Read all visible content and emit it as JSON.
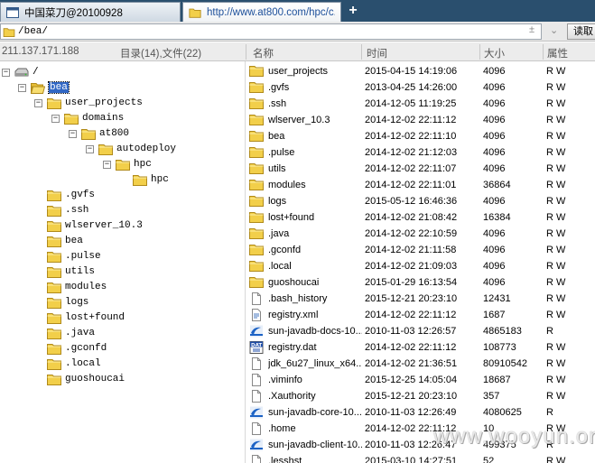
{
  "tabs": [
    {
      "label": "中国菜刀@20100928"
    },
    {
      "label": "http://www.at800.com/hpc/c..."
    }
  ],
  "new_tab_label": "+",
  "address": {
    "value": "/bea/",
    "read_button": "读取",
    "controls": [
      "±",
      "⌄"
    ]
  },
  "header": {
    "host": "211.137.171.188",
    "summary": "目录(14),文件(22)",
    "col_name": "名称",
    "col_time": "时间",
    "col_size": "大小",
    "col_attr": "属性"
  },
  "tree": [
    {
      "label": "/",
      "level": 0,
      "icon": "drive-icon",
      "expander": "−"
    },
    {
      "label": "bea",
      "level": 1,
      "icon": "folder-open-icon",
      "expander": "−",
      "selected": true
    },
    {
      "label": "user_projects",
      "level": 2,
      "icon": "folder-icon",
      "expander": "−"
    },
    {
      "label": "domains",
      "level": 3,
      "icon": "folder-icon",
      "expander": "−"
    },
    {
      "label": "at800",
      "level": 4,
      "icon": "folder-icon",
      "expander": "−"
    },
    {
      "label": "autodeploy",
      "level": 5,
      "icon": "folder-icon",
      "expander": "−"
    },
    {
      "label": "hpc",
      "level": 6,
      "icon": "folder-icon",
      "expander": "−"
    },
    {
      "label": "hpc",
      "level": 7,
      "icon": "folder-icon",
      "expander": ""
    },
    {
      "label": ".gvfs",
      "level": 2,
      "icon": "folder-icon",
      "expander": ""
    },
    {
      "label": ".ssh",
      "level": 2,
      "icon": "folder-icon",
      "expander": ""
    },
    {
      "label": "wlserver_10.3",
      "level": 2,
      "icon": "folder-icon",
      "expander": ""
    },
    {
      "label": "bea",
      "level": 2,
      "icon": "folder-icon",
      "expander": ""
    },
    {
      "label": ".pulse",
      "level": 2,
      "icon": "folder-icon",
      "expander": ""
    },
    {
      "label": "utils",
      "level": 2,
      "icon": "folder-icon",
      "expander": ""
    },
    {
      "label": "modules",
      "level": 2,
      "icon": "folder-icon",
      "expander": ""
    },
    {
      "label": "logs",
      "level": 2,
      "icon": "folder-icon",
      "expander": ""
    },
    {
      "label": "lost+found",
      "level": 2,
      "icon": "folder-icon",
      "expander": ""
    },
    {
      "label": ".java",
      "level": 2,
      "icon": "folder-icon",
      "expander": ""
    },
    {
      "label": ".gconfd",
      "level": 2,
      "icon": "folder-icon",
      "expander": ""
    },
    {
      "label": ".local",
      "level": 2,
      "icon": "folder-icon",
      "expander": ""
    },
    {
      "label": "guoshoucai",
      "level": 2,
      "icon": "folder-icon",
      "expander": ""
    }
  ],
  "files": [
    {
      "name": "user_projects",
      "time": "2015-04-15 14:19:06",
      "size": "4096",
      "attr": "R W",
      "icon": "folder-icon"
    },
    {
      "name": ".gvfs",
      "time": "2013-04-25 14:26:00",
      "size": "4096",
      "attr": "R W",
      "icon": "folder-icon"
    },
    {
      "name": ".ssh",
      "time": "2014-12-05 11:19:25",
      "size": "4096",
      "attr": "R W",
      "icon": "folder-icon"
    },
    {
      "name": "wlserver_10.3",
      "time": "2014-12-02 22:11:12",
      "size": "4096",
      "attr": "R W",
      "icon": "folder-icon"
    },
    {
      "name": "bea",
      "time": "2014-12-02 22:11:10",
      "size": "4096",
      "attr": "R W",
      "icon": "folder-icon"
    },
    {
      "name": ".pulse",
      "time": "2014-12-02 21:12:03",
      "size": "4096",
      "attr": "R W",
      "icon": "folder-icon"
    },
    {
      "name": "utils",
      "time": "2014-12-02 22:11:07",
      "size": "4096",
      "attr": "R W",
      "icon": "folder-icon"
    },
    {
      "name": "modules",
      "time": "2014-12-02 22:11:01",
      "size": "36864",
      "attr": "R W",
      "icon": "folder-icon"
    },
    {
      "name": "logs",
      "time": "2015-05-12 16:46:36",
      "size": "4096",
      "attr": "R W",
      "icon": "folder-icon"
    },
    {
      "name": "lost+found",
      "time": "2014-12-02 21:08:42",
      "size": "16384",
      "attr": "R W",
      "icon": "folder-icon"
    },
    {
      "name": ".java",
      "time": "2014-12-02 22:10:59",
      "size": "4096",
      "attr": "R W",
      "icon": "folder-icon"
    },
    {
      "name": ".gconfd",
      "time": "2014-12-02 21:11:58",
      "size": "4096",
      "attr": "R W",
      "icon": "folder-icon"
    },
    {
      "name": ".local",
      "time": "2014-12-02 21:09:03",
      "size": "4096",
      "attr": "R W",
      "icon": "folder-icon"
    },
    {
      "name": "guoshoucai",
      "time": "2015-01-29 16:13:54",
      "size": "4096",
      "attr": "R W",
      "icon": "folder-icon"
    },
    {
      "name": ".bash_history",
      "time": "2015-12-21 20:23:10",
      "size": "12431",
      "attr": "R W",
      "icon": "file-icon"
    },
    {
      "name": "registry.xml",
      "time": "2014-12-02 22:11:12",
      "size": "1687",
      "attr": "R W",
      "icon": "xml-file-icon"
    },
    {
      "name": "sun-javadb-docs-10....",
      "time": "2010-11-03 12:26:57",
      "size": "4865183",
      "attr": "R",
      "icon": "package-icon"
    },
    {
      "name": "registry.dat",
      "time": "2014-12-02 22:11:12",
      "size": "108773",
      "attr": "R W",
      "icon": "dat-file-icon"
    },
    {
      "name": "jdk_6u27_linux_x64....",
      "time": "2014-12-02 21:36:51",
      "size": "80910542",
      "attr": "R W",
      "icon": "file-icon"
    },
    {
      "name": ".viminfo",
      "time": "2015-12-25 14:05:04",
      "size": "18687",
      "attr": "R W",
      "icon": "file-icon"
    },
    {
      "name": ".Xauthority",
      "time": "2015-12-21 20:23:10",
      "size": "357",
      "attr": "R W",
      "icon": "file-icon"
    },
    {
      "name": "sun-javadb-core-10....",
      "time": "2010-11-03 12:26:49",
      "size": "4080625",
      "attr": "R",
      "icon": "package-icon"
    },
    {
      "name": ".home",
      "time": "2014-12-02 22:11:12",
      "size": "10",
      "attr": "R W",
      "icon": "file-icon"
    },
    {
      "name": "sun-javadb-client-10...",
      "time": "2010-11-03 12:26:47",
      "size": "499375",
      "attr": "R",
      "icon": "package-icon"
    },
    {
      "name": ".lesshst",
      "time": "2015-03-10 14:27:51",
      "size": "52",
      "attr": "R W",
      "icon": "file-icon"
    }
  ],
  "watermark": "www.wooyun.org",
  "colors": {
    "folder": "#f2cf4a",
    "selection": "#3167c4",
    "tabbar": "#2a4f6e"
  }
}
